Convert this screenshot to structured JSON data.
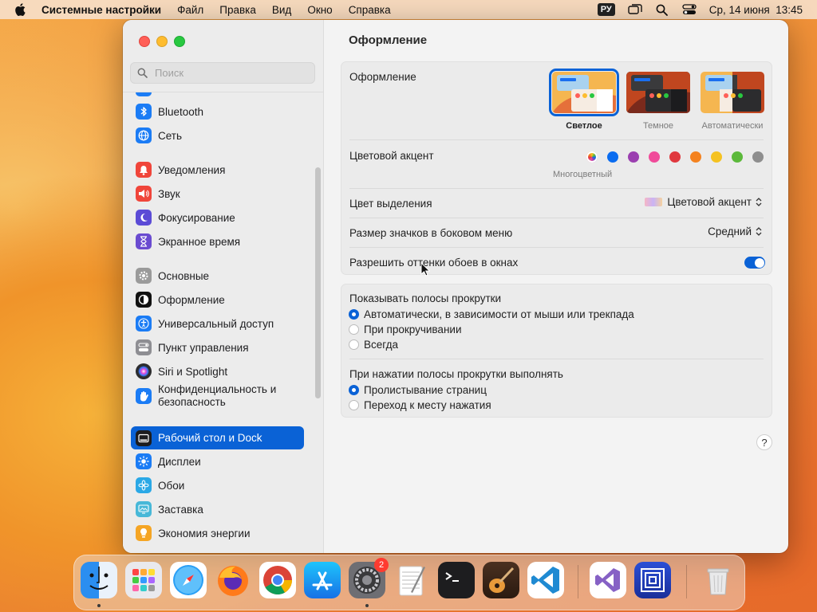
{
  "menubar": {
    "app_name": "Системные настройки",
    "items": [
      "Файл",
      "Правка",
      "Вид",
      "Окно",
      "Справка"
    ],
    "input_source": "РУ",
    "datetime": "Ср, 14 июня  13:45"
  },
  "sidebar": {
    "search_placeholder": "Поиск",
    "items": [
      {
        "label": "Bluetooth",
        "icon": "bluetooth-icon",
        "color": "#1b7cf5"
      },
      {
        "label": "Сеть",
        "icon": "globe-icon",
        "color": "#1b7cf5"
      },
      {
        "label": "Уведомления",
        "icon": "bell-icon",
        "color": "#f0453a"
      },
      {
        "label": "Звук",
        "icon": "speaker-icon",
        "color": "#f0453a"
      },
      {
        "label": "Фокусирование",
        "icon": "moon-icon",
        "color": "#5b4bd6"
      },
      {
        "label": "Экранное время",
        "icon": "hourglass-icon",
        "color": "#6a4bd0"
      },
      {
        "label": "Основные",
        "icon": "gear-icon",
        "color": "#9a9a9a"
      },
      {
        "label": "Оформление",
        "icon": "appearance-icon",
        "color": "#111111"
      },
      {
        "label": "Универсальный доступ",
        "icon": "accessibility-icon",
        "color": "#1b7cf5"
      },
      {
        "label": "Пункт управления",
        "icon": "control-center-icon",
        "color": "#8e8e93"
      },
      {
        "label": "Siri и Spotlight",
        "icon": "siri-icon",
        "color": "#2c2c2e"
      },
      {
        "label": "Конфиденциальность и",
        "label2": "безопасность",
        "icon": "hand-icon",
        "color": "#1b7cf5"
      },
      {
        "label": "Рабочий стол и Dock",
        "icon": "dock-icon",
        "color": "#1d1d1f",
        "selected": true
      },
      {
        "label": "Дисплеи",
        "icon": "sun-icon",
        "color": "#1b7cf5"
      },
      {
        "label": "Обои",
        "icon": "flower-icon",
        "color": "#2aa8e6"
      },
      {
        "label": "Заставка",
        "icon": "screensaver-icon",
        "color": "#47b8d8"
      },
      {
        "label": "Экономия энергии",
        "icon": "bulb-icon",
        "color": "#f5a524"
      }
    ]
  },
  "content": {
    "title": "Оформление",
    "appearance": {
      "label": "Оформление",
      "options": [
        {
          "label": "Светлое",
          "selected": true
        },
        {
          "label": "Темное",
          "selected": false
        },
        {
          "label": "Автоматически",
          "selected": false
        }
      ]
    },
    "accent": {
      "label": "Цветовой акцент",
      "caption": "Многоцветный",
      "colors": [
        "multicolor",
        "#0a6cf0",
        "#9b3fb0",
        "#f04b9a",
        "#e0383e",
        "#f4821f",
        "#f5c221",
        "#5cb93b",
        "#8e8e8e"
      ]
    },
    "highlight": {
      "label": "Цвет выделения",
      "value": "Цветовой акцент"
    },
    "sidebar_icon_size": {
      "label": "Размер значков в боковом меню",
      "value": "Средний"
    },
    "wallpaper_tinting": {
      "label": "Разрешить оттенки обоев в окнах",
      "on": true
    },
    "scrollbars": {
      "label": "Показывать полосы прокрутки",
      "options": [
        {
          "label": "Автоматически, в зависимости от мыши или трекпада",
          "selected": true
        },
        {
          "label": "При прокручивании",
          "selected": false
        },
        {
          "label": "Всегда",
          "selected": false
        }
      ]
    },
    "click_scrollbar": {
      "label": "При нажатии полосы прокрутки выполнять",
      "options": [
        {
          "label": "Пролистывание страниц",
          "selected": true
        },
        {
          "label": "Переход к месту нажатия",
          "selected": false
        }
      ]
    },
    "help": "?"
  },
  "dock": {
    "apps": [
      {
        "name": "finder-icon",
        "running": true
      },
      {
        "name": "launchpad-icon",
        "running": false
      },
      {
        "name": "safari-icon",
        "running": false
      },
      {
        "name": "firefox-icon",
        "running": false
      },
      {
        "name": "chrome-icon",
        "running": false
      },
      {
        "name": "app-store-icon",
        "running": false
      },
      {
        "name": "system-settings-icon",
        "running": true,
        "badge": "2"
      },
      {
        "name": "textedit-icon",
        "running": false
      },
      {
        "name": "terminal-icon",
        "running": false
      },
      {
        "name": "garageband-icon",
        "running": false
      },
      {
        "name": "vscode-icon",
        "running": false
      },
      {
        "name": "visual-studio-icon",
        "running": false
      },
      {
        "name": "simulator-icon",
        "running": false
      },
      {
        "name": "trash-icon",
        "running": false
      }
    ]
  }
}
